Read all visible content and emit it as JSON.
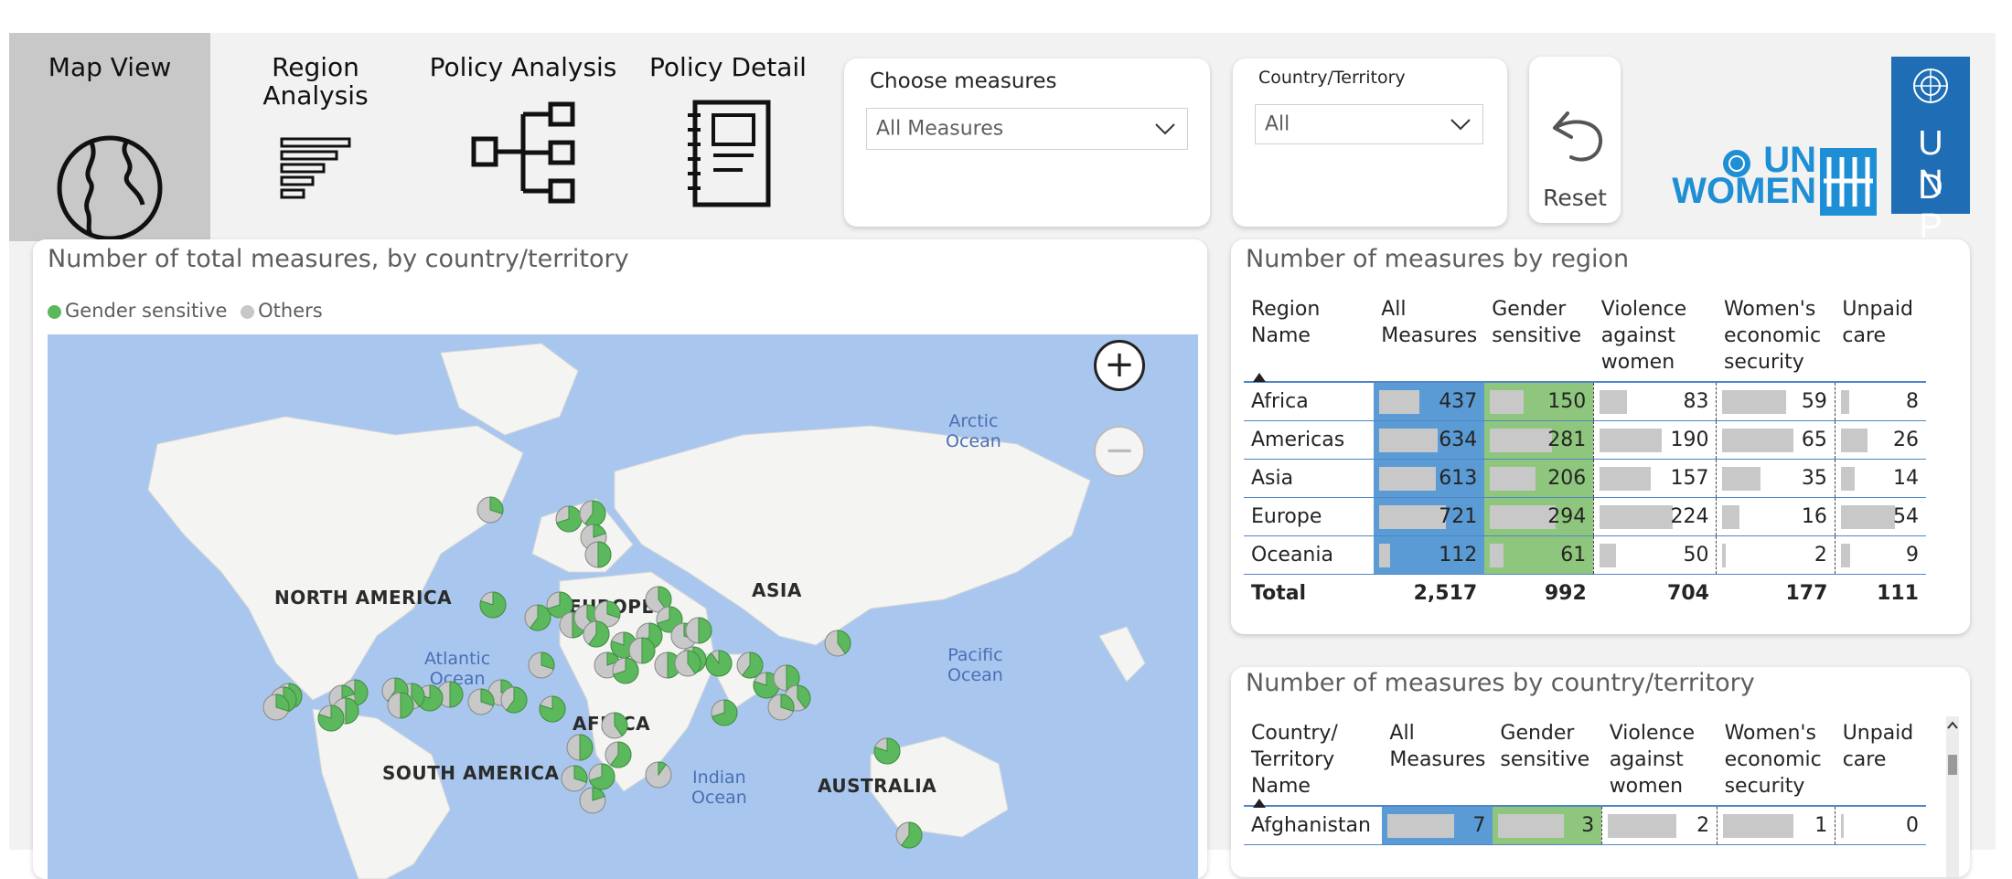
{
  "nav": {
    "tabs": [
      {
        "label": "Map View",
        "icon": "globe-icon"
      },
      {
        "label": "Region\nAnalysis",
        "icon": "bar-list-icon"
      },
      {
        "label": "Policy Analysis",
        "icon": "hierarchy-icon"
      },
      {
        "label": "Policy Detail",
        "icon": "notebook-icon"
      }
    ]
  },
  "slicers": {
    "measures": {
      "title": "Choose measures",
      "value": "All Measures"
    },
    "country": {
      "title": "Country/Territory",
      "value": "All"
    }
  },
  "reset": {
    "label": "Reset",
    "icon": "undo-arrow-icon"
  },
  "logos": {
    "un_women": "UN\nWOMEN",
    "undp_top": "U N",
    "undp_bottom": "D P"
  },
  "map_card": {
    "title": "Number of total measures, by country/territory",
    "legend": [
      {
        "label": "Gender sensitive",
        "color": "#5cb85c"
      },
      {
        "label": "Others",
        "color": "#c8c8c8"
      }
    ],
    "continents": [
      "NORTH AMERICA",
      "EUROPE",
      "ASIA",
      "AFRICA",
      "SOUTH AMERICA",
      "AUSTRALIA"
    ],
    "oceans": [
      "Arctic\nOcean",
      "Atlantic\nOcean",
      "Pacific\nOcean",
      "Indian\nOcean"
    ],
    "zoom_in": "+",
    "zoom_out": "−"
  },
  "region_table": {
    "title": "Number of measures by region",
    "headers": [
      "Region\nName",
      "All\nMeasures",
      "Gender\nsensitive",
      "Violence\nagainst\nwomen",
      "Women's\neconomic\nsecurity",
      "Unpaid\ncare"
    ],
    "rows": [
      {
        "name": "Africa",
        "values": [
          "437",
          "150",
          "83",
          "59",
          "8"
        ]
      },
      {
        "name": "Americas",
        "values": [
          "634",
          "281",
          "190",
          "65",
          "26"
        ]
      },
      {
        "name": "Asia",
        "values": [
          "613",
          "206",
          "157",
          "35",
          "14"
        ]
      },
      {
        "name": "Europe",
        "values": [
          "721",
          "294",
          "224",
          "16",
          "54"
        ]
      },
      {
        "name": "Oceania",
        "values": [
          "112",
          "61",
          "50",
          "2",
          "9"
        ]
      }
    ],
    "total": {
      "name": "Total",
      "values": [
        "2,517",
        "992",
        "704",
        "177",
        "111"
      ]
    }
  },
  "country_table": {
    "title": "Number of measures by country/territory",
    "headers": [
      "Country/\nTerritory\nName",
      "All\nMeasures",
      "Gender\nsensitive",
      "Violence\nagainst\nwomen",
      "Women's\neconomic\nsecurity",
      "Unpaid\ncare"
    ],
    "rows": [
      {
        "name": "Afghanistan",
        "values": [
          "7",
          "3",
          "2",
          "1",
          "0"
        ]
      }
    ]
  },
  "colors": {
    "accent_blue": "#5a9bd5",
    "accent_green": "#8fc67e",
    "un_blue": "#1e8fd5",
    "undp_blue": "#1f6db5"
  }
}
